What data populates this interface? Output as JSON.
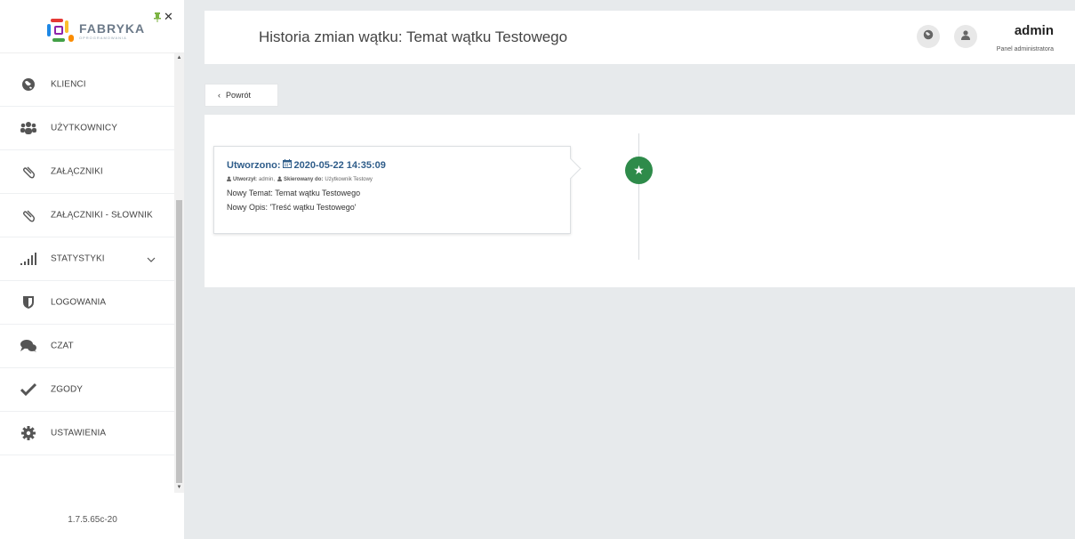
{
  "app": {
    "logo_title": "FABRYKA",
    "logo_subtitle": "OPROGRAMOWANIA",
    "version": "1.7.5.65c-20"
  },
  "sidebar": {
    "items": [
      {
        "label": "KLIENCI",
        "icon": "globe-icon"
      },
      {
        "label": "UŻYTKOWNICY",
        "icon": "users-icon"
      },
      {
        "label": "ZAŁĄCZNIKI",
        "icon": "paperclip-icon"
      },
      {
        "label": "ZAŁĄCZNIKI - SŁOWNIK",
        "icon": "paperclip-icon"
      },
      {
        "label": "STATYSTYKI",
        "icon": "signal-icon"
      },
      {
        "label": "LOGOWANIA",
        "icon": "shield-icon"
      },
      {
        "label": "CZAT",
        "icon": "chat-icon"
      },
      {
        "label": "ZGODY",
        "icon": "check-icon"
      },
      {
        "label": "USTAWIENIA",
        "icon": "gear-icon"
      }
    ]
  },
  "header": {
    "title": "Historia zmian wątku: Temat wątku Testowego",
    "user_name": "admin",
    "user_role": "Panel administratora"
  },
  "back_button": {
    "label": "Powrót"
  },
  "timeline": {
    "entries": [
      {
        "created_label": "Utworzono:",
        "created_at": "2020-05-22 14:35:09",
        "created_by_label": "Utworzył:",
        "created_by": "admin,",
        "assigned_label": "Skierowany do:",
        "assigned_to": "Użytkownik Testowy",
        "line1": "Nowy Temat: Temat wątku Testowego",
        "line2": "Nowy Opis: 'Treść wątku Testowego'"
      }
    ]
  },
  "colors": {
    "accent_green": "#2e8b4a",
    "title_blue": "#2f5d8a",
    "background": "#e7eaec"
  }
}
